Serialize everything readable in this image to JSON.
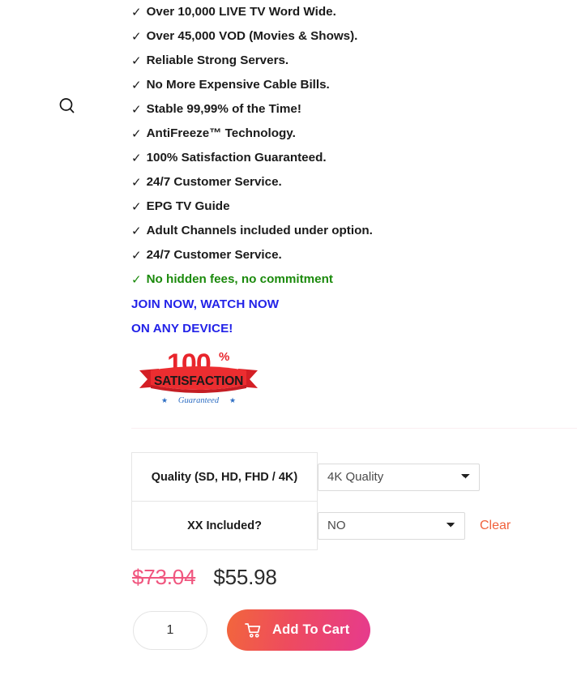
{
  "search": {
    "icon": "search-icon"
  },
  "features": [
    {
      "text": "Over 10,000 LIVE TV Word Wide.",
      "color": "#1a1a1a"
    },
    {
      "text": "Over 45,000 VOD (Movies & Shows).",
      "color": "#1a1a1a"
    },
    {
      "text": "Reliable Strong Servers.",
      "color": "#1a1a1a"
    },
    {
      "text": "No More Expensive Cable Bills.",
      "color": "#1a1a1a"
    },
    {
      "text": "Stable 99,99% of the Time!",
      "color": "#1a1a1a"
    },
    {
      "text": "AntiFreeze™ Technology.",
      "color": "#1a1a1a"
    },
    {
      "text": "100% Satisfaction Guaranteed.",
      "color": "#1a1a1a"
    },
    {
      "text": "24/7 Customer Service.",
      "color": "#1a1a1a"
    },
    {
      "text": "EPG TV Guide",
      "color": "#1a1a1a"
    },
    {
      "text": "Adult Channels included under option.",
      "color": "#1a1a1a"
    },
    {
      "text": "24/7 Customer Service.",
      "color": "#1a1a1a"
    },
    {
      "text": "No hidden fees, no commitment",
      "color": "#1b8a0c"
    }
  ],
  "check_glyph": "✓",
  "promo": {
    "line1": "JOIN NOW, WATCH NOW",
    "line2": "ON ANY DEVICE!",
    "color": "#2222e8"
  },
  "badge": {
    "percent": "100",
    "percent_symbol": "%",
    "ribbon_text": "SATISFACTION",
    "guarantee_text": "Guaranteed",
    "star_glyph": "★",
    "red": "#e8252c",
    "ribbon_red": "#ec2d30",
    "blue": "#2f6fc4"
  },
  "variations": [
    {
      "label": "Quality (SD, HD, FHD / 4K)",
      "selected": "4K Quality",
      "options": [
        "4K Quality"
      ]
    },
    {
      "label": "XX Included?",
      "selected": "NO",
      "options": [
        "NO"
      ]
    }
  ],
  "clear_label": "Clear",
  "clear_color": "#f0613c",
  "price": {
    "original": "$73.04",
    "sale": "$55.98",
    "original_color": "#f0567f",
    "sale_color": "#2b2b2b"
  },
  "cart": {
    "quantity": "1",
    "quantity_placeholder": "1",
    "button_label": "Add To Cart",
    "icon": "shopping-cart-icon",
    "gradient_from": "#f2663c",
    "gradient_to": "#e63a8e"
  }
}
